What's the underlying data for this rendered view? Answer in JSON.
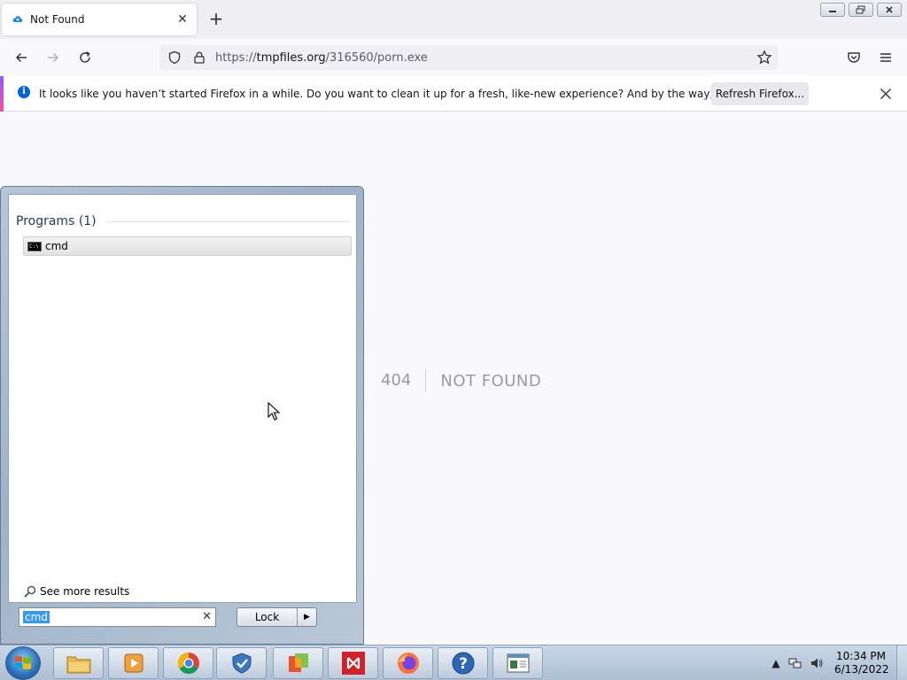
{
  "browser": {
    "tab": {
      "title": "Not Found"
    },
    "url": {
      "scheme": "https://",
      "host": "tmpfiles.org",
      "path": "/316560/porn.exe"
    },
    "notification": {
      "message": "It looks like you haven’t started Firefox in a while. Do you want to clean it up for a fresh, like-new experience? And by the way, welcome back!",
      "button_label": "Refresh Firefox..."
    }
  },
  "page": {
    "code": "404",
    "text": "NOT FOUND"
  },
  "start_menu": {
    "section_title": "Programs (1)",
    "results": [
      {
        "label": "cmd",
        "icon": "cmd-icon"
      }
    ],
    "see_more": "See more results",
    "search_value": "cmd",
    "power_button": "Lock"
  },
  "taskbar": {
    "apps": [
      "file-explorer",
      "media-player",
      "chrome",
      "security",
      "office",
      "visual-studio",
      "firefox",
      "help",
      "documents"
    ],
    "clock": {
      "time": "10:34 PM",
      "date": "6/13/2022"
    }
  }
}
